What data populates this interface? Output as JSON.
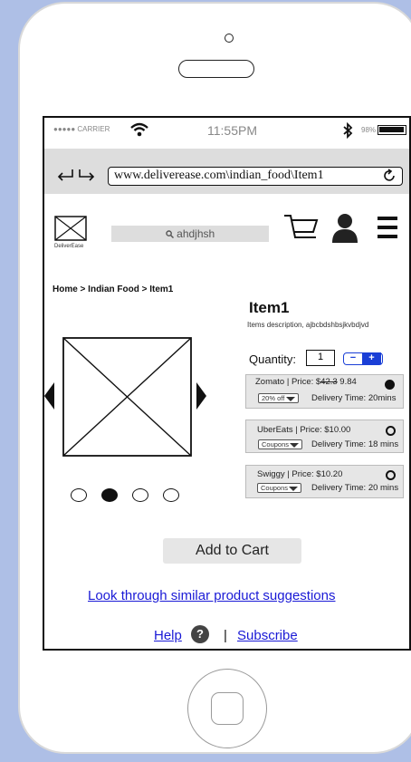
{
  "status": {
    "carrier": "●●●●● CARRIER",
    "time": "11:55PM",
    "battery": "98%"
  },
  "browser": {
    "url": "www.deliverease.com\\indian_food\\Item1"
  },
  "header": {
    "logo_caption": "DeliverEase",
    "search_value": "ahdjhsh"
  },
  "breadcrumb": "Home > Indian Food > Item1",
  "product": {
    "title": "Item1",
    "description": "Items description, ajbcbdshbsjkvbdjvd",
    "quantity_label": "Quantity:",
    "quantity_value": "1"
  },
  "offers": [
    {
      "vendor_line_prefix": "Zomato | Price: $",
      "old_price": "42.3",
      "new_price": " 9.84",
      "coupon": "20% off",
      "delivery": "Delivery Time: 20mins",
      "selected": true
    },
    {
      "vendor_line": "UberEats | Price: $10.00",
      "coupon": "Coupons",
      "delivery": "Delivery Time: 18 mins",
      "selected": false
    },
    {
      "vendor_line": "Swiggy | Price: $10.20",
      "coupon": "Coupons",
      "delivery": "Delivery Time: 20 mins",
      "selected": false
    }
  ],
  "carousel": {
    "total": 4,
    "active_index": 1
  },
  "actions": {
    "add_to_cart": "Add to Cart",
    "suggestions": "Look through similar product suggestions",
    "help": "Help",
    "help_icon": "?",
    "separator": "|",
    "subscribe": "Subscribe"
  },
  "icons": [
    "wifi-icon",
    "bluetooth-icon",
    "battery-icon",
    "back-icon",
    "forward-icon",
    "refresh-icon",
    "search-icon",
    "cart-icon",
    "user-icon",
    "menu-icon"
  ]
}
